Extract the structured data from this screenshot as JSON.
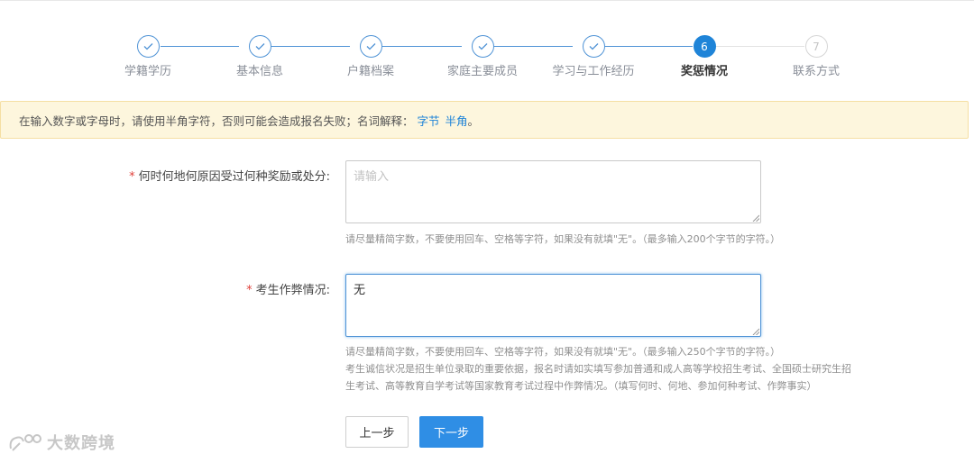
{
  "steps": [
    {
      "label": "学籍学历",
      "status": "done"
    },
    {
      "label": "基本信息",
      "status": "done"
    },
    {
      "label": "户籍档案",
      "status": "done"
    },
    {
      "label": "家庭主要成员",
      "status": "done"
    },
    {
      "label": "学习与工作经历",
      "status": "done"
    },
    {
      "label": "奖惩情况",
      "status": "active",
      "number": "6"
    },
    {
      "label": "联系方式",
      "status": "todo",
      "number": "7"
    }
  ],
  "notice": {
    "text": "在输入数字或字母时，请使用半角字符，否则可能会造成报名失败；名词解释：",
    "link1": "字节",
    "link2": "半角",
    "suffix": "。"
  },
  "form": {
    "reward_punishment": {
      "required_mark": "*",
      "label": "何时何地何原因受过何种奖励或处分:",
      "placeholder": "请输入",
      "value": "",
      "hint": "请尽量精简字数，不要使用回车、空格等字符，如果没有就填\"无\"。（最多输入200个字节的字符。）"
    },
    "cheating": {
      "required_mark": "*",
      "label": "考生作弊情况:",
      "value": "无",
      "hint_line1": "请尽量精简字数，不要使用回车、空格等字符，如果没有就填\"无\"。（最多输入250个字节的字符。）",
      "hint_line2": "考生诚信状况是招生单位录取的重要依据，报名时请如实填写参加普通和成人高等学校招生考试、全国硕士研究生招",
      "hint_line3": "生考试、高等教育自学考试等国家教育考试过程中作弊情况。（填写何时、何地、参加何种考试、作弊事实）"
    }
  },
  "buttons": {
    "prev": "上一步",
    "next": "下一步"
  },
  "watermark": {
    "text": "大数跨境"
  },
  "colors": {
    "accent": "#1f84d8",
    "notice_bg": "#fdf6dd",
    "required": "#e0403a"
  }
}
